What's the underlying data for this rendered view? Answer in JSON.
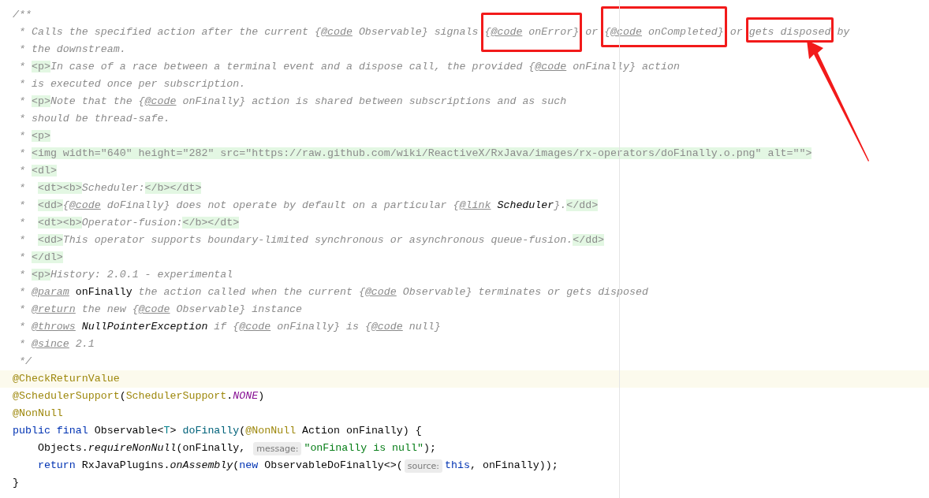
{
  "editor": {
    "lines": [
      {
        "current": false,
        "segments": [
          {
            "kind": "comment",
            "text": "/**"
          }
        ]
      },
      {
        "current": false,
        "segments": [
          {
            "kind": "comment",
            "text": " * Calls the specified action after the current {"
          },
          {
            "kind": "tag",
            "text": "@code"
          },
          {
            "kind": "comment",
            "text": " Observable} signals "
          },
          {
            "kind": "comment",
            "text": "{",
            "boxed": true
          },
          {
            "kind": "tag",
            "text": "@code",
            "boxed": true
          },
          {
            "kind": "comment",
            "text": " onError}",
            "boxed": true
          },
          {
            "kind": "comment",
            "text": " or "
          },
          {
            "kind": "comment",
            "text": "{",
            "boxed": true
          },
          {
            "kind": "tag",
            "text": "@code",
            "boxed": true
          },
          {
            "kind": "comment",
            "text": " onCompleted}",
            "boxed": true
          },
          {
            "kind": "comment",
            "text": " or "
          },
          {
            "kind": "comment",
            "text": "gets disposed",
            "boxed": true
          },
          {
            "kind": "comment",
            "text": " by"
          }
        ]
      },
      {
        "current": false,
        "segments": [
          {
            "kind": "comment",
            "text": " * the downstream."
          }
        ]
      },
      {
        "current": false,
        "segments": [
          {
            "kind": "comment",
            "text": " * "
          },
          {
            "kind": "html",
            "text": "<p>"
          },
          {
            "kind": "comment",
            "text": "In case of a race between a terminal event and a dispose call, the provided {"
          },
          {
            "kind": "tag",
            "text": "@code"
          },
          {
            "kind": "comment",
            "text": " onFinally} action"
          }
        ]
      },
      {
        "current": false,
        "segments": [
          {
            "kind": "comment",
            "text": " * is executed once per subscription."
          }
        ]
      },
      {
        "current": false,
        "segments": [
          {
            "kind": "comment",
            "text": " * "
          },
          {
            "kind": "html",
            "text": "<p>"
          },
          {
            "kind": "comment",
            "text": "Note that the {"
          },
          {
            "kind": "tag",
            "text": "@code"
          },
          {
            "kind": "comment",
            "text": " onFinally} action is shared between subscriptions and as such"
          }
        ]
      },
      {
        "current": false,
        "segments": [
          {
            "kind": "comment",
            "text": " * should be thread-safe."
          }
        ]
      },
      {
        "current": false,
        "segments": [
          {
            "kind": "comment",
            "text": " * "
          },
          {
            "kind": "html",
            "text": "<p>"
          }
        ]
      },
      {
        "current": false,
        "segments": [
          {
            "kind": "comment",
            "text": " * "
          },
          {
            "kind": "html",
            "text": "<img width=\"640\" height=\"282\" src=\"https://raw.github.com/wiki/ReactiveX/RxJava/images/rx-operators/doFinally.o.png\" alt=\"\">"
          }
        ]
      },
      {
        "current": false,
        "segments": [
          {
            "kind": "comment",
            "text": " * "
          },
          {
            "kind": "html",
            "text": "<dl>"
          }
        ]
      },
      {
        "current": false,
        "segments": [
          {
            "kind": "comment",
            "text": " *  "
          },
          {
            "kind": "html",
            "text": "<dt><b>"
          },
          {
            "kind": "comment",
            "text": "Scheduler:"
          },
          {
            "kind": "html",
            "text": "</b></dt>"
          }
        ]
      },
      {
        "current": false,
        "segments": [
          {
            "kind": "comment",
            "text": " *  "
          },
          {
            "kind": "html",
            "text": "<dd>"
          },
          {
            "kind": "comment",
            "text": "{"
          },
          {
            "kind": "tag",
            "text": "@code"
          },
          {
            "kind": "comment",
            "text": " doFinally} does not operate by default on a particular {"
          },
          {
            "kind": "tag",
            "text": "@link"
          },
          {
            "kind": "ref",
            "text": "Scheduler"
          },
          {
            "kind": "comment",
            "text": "}."
          },
          {
            "kind": "html",
            "text": "</dd>"
          }
        ]
      },
      {
        "current": false,
        "segments": [
          {
            "kind": "comment",
            "text": " *  "
          },
          {
            "kind": "html",
            "text": "<dt><b>"
          },
          {
            "kind": "comment",
            "text": "Operator-fusion:"
          },
          {
            "kind": "html",
            "text": "</b></dt>"
          }
        ]
      },
      {
        "current": false,
        "segments": [
          {
            "kind": "comment",
            "text": " *  "
          },
          {
            "kind": "html",
            "text": "<dd>"
          },
          {
            "kind": "comment",
            "text": "This operator supports boundary-limited synchronous or asynchronous queue-fusion."
          },
          {
            "kind": "html",
            "text": "</dd>"
          }
        ]
      },
      {
        "current": false,
        "segments": [
          {
            "kind": "comment",
            "text": " * "
          },
          {
            "kind": "html",
            "text": "</dl>"
          }
        ]
      },
      {
        "current": false,
        "segments": [
          {
            "kind": "comment",
            "text": " * "
          },
          {
            "kind": "html",
            "text": "<p>"
          },
          {
            "kind": "comment",
            "text": "History: 2.0.1 - experimental"
          }
        ]
      },
      {
        "current": false,
        "segments": [
          {
            "kind": "comment",
            "text": " * "
          },
          {
            "kind": "tag",
            "text": "@param"
          },
          {
            "kind": "param",
            "text": "onFinally"
          },
          {
            "kind": "comment",
            "text": " the action called when the current {"
          },
          {
            "kind": "tag",
            "text": "@code"
          },
          {
            "kind": "comment",
            "text": " Observable} terminates or gets disposed"
          }
        ]
      },
      {
        "current": false,
        "segments": [
          {
            "kind": "comment",
            "text": " * "
          },
          {
            "kind": "tag",
            "text": "@return"
          },
          {
            "kind": "comment",
            "text": " the new {"
          },
          {
            "kind": "tag",
            "text": "@code"
          },
          {
            "kind": "comment",
            "text": " Observable} instance"
          }
        ]
      },
      {
        "current": false,
        "segments": [
          {
            "kind": "comment",
            "text": " * "
          },
          {
            "kind": "tag",
            "text": "@throws"
          },
          {
            "kind": "ref",
            "text": "NullPointerException"
          },
          {
            "kind": "comment",
            "text": " if {"
          },
          {
            "kind": "tag",
            "text": "@code"
          },
          {
            "kind": "comment",
            "text": " onFinally} is {"
          },
          {
            "kind": "tag",
            "text": "@code"
          },
          {
            "kind": "comment",
            "text": " null}"
          }
        ]
      },
      {
        "current": false,
        "segments": [
          {
            "kind": "comment",
            "text": " * "
          },
          {
            "kind": "tag",
            "text": "@since"
          },
          {
            "kind": "comment",
            "text": " 2.1"
          }
        ]
      },
      {
        "current": false,
        "segments": [
          {
            "kind": "comment",
            "text": " */"
          }
        ]
      },
      {
        "current": true,
        "segments": [
          {
            "kind": "annotation",
            "text": "@CheckReturnValue"
          }
        ]
      },
      {
        "current": false,
        "segments": [
          {
            "kind": "annotation",
            "text": "@SchedulerSupport"
          },
          {
            "kind": "plain",
            "text": "("
          },
          {
            "kind": "annotation",
            "text": "SchedulerSupport"
          },
          {
            "kind": "plain",
            "text": "."
          },
          {
            "kind": "constant",
            "text": "NONE"
          },
          {
            "kind": "plain",
            "text": ")"
          }
        ]
      },
      {
        "current": false,
        "segments": [
          {
            "kind": "annotation",
            "text": "@NonNull"
          }
        ]
      },
      {
        "current": false,
        "segments": [
          {
            "kind": "keyword",
            "text": "public final "
          },
          {
            "kind": "plain",
            "text": "Observable<"
          },
          {
            "kind": "typeparam",
            "text": "T"
          },
          {
            "kind": "plain",
            "text": "> "
          },
          {
            "kind": "method",
            "text": "doFinally"
          },
          {
            "kind": "plain",
            "text": "("
          },
          {
            "kind": "annotation",
            "text": "@NonNull"
          },
          {
            "kind": "plain",
            "text": " Action onFinally) {"
          }
        ]
      },
      {
        "current": false,
        "segments": [
          {
            "kind": "plain",
            "text": "    Objects."
          },
          {
            "kind": "call",
            "text": "requireNonNull"
          },
          {
            "kind": "plain",
            "text": "(onFinally, "
          },
          {
            "kind": "hint",
            "text": "message:"
          },
          {
            "kind": "string",
            "text": "\"onFinally is null\""
          },
          {
            "kind": "plain",
            "text": ");"
          }
        ]
      },
      {
        "current": false,
        "segments": [
          {
            "kind": "keyword",
            "text": "    return "
          },
          {
            "kind": "plain",
            "text": "RxJavaPlugins."
          },
          {
            "kind": "call",
            "text": "onAssembly"
          },
          {
            "kind": "plain",
            "text": "("
          },
          {
            "kind": "keyword",
            "text": "new "
          },
          {
            "kind": "plain",
            "text": "ObservableDoFinally<>("
          },
          {
            "kind": "hint",
            "text": "source:"
          },
          {
            "kind": "keyword",
            "text": "this"
          },
          {
            "kind": "plain",
            "text": ", onFinally));"
          }
        ]
      },
      {
        "current": false,
        "segments": [
          {
            "kind": "plain",
            "text": "}"
          }
        ]
      }
    ]
  }
}
